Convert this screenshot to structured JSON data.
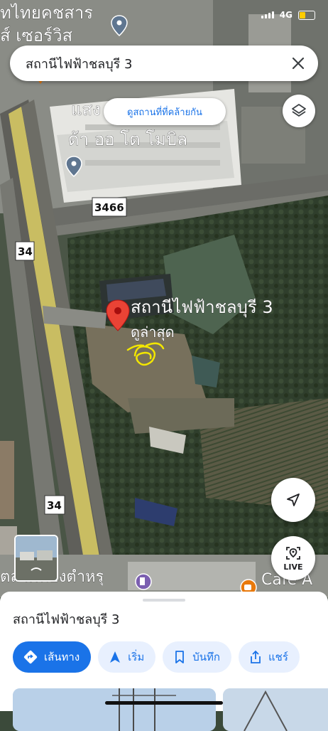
{
  "status_bar": {
    "network": "4G"
  },
  "search": {
    "query": "สถานีไฟฟ้าชลบุรี 3"
  },
  "similar_button": {
    "label": "ดูสถานที่ที่คล้ายกัน"
  },
  "map_labels": {
    "top_left_1": "ทไทยคชสาร",
    "top_left_2": "ส์ เซอร์วิส",
    "building_1": "แสง",
    "building_2": "ด้า ออ โต โมบิล",
    "road_3466": "3466",
    "road_34_a": "34",
    "road_34_b": "34",
    "place_name": "สถานีไฟฟ้าชลบุรี 3",
    "place_sub": "ดูล่าสุด",
    "bottom_left": "ตลาดนองตำหรุ",
    "bottom_right": "Cafe A"
  },
  "live_button": {
    "label": "LIVE"
  },
  "sheet": {
    "title": "สถานีไฟฟ้าชลบุรี 3",
    "actions": [
      {
        "label": "เส้นทาง",
        "icon": "directions-icon"
      },
      {
        "label": "เริ่ม",
        "icon": "navigation-arrow-icon"
      },
      {
        "label": "บันทึก",
        "icon": "bookmark-icon"
      },
      {
        "label": "แชร์",
        "icon": "share-icon"
      }
    ]
  },
  "colors": {
    "accent": "#1a73e8",
    "pin": "#ea4335",
    "annotation": "#f2e600"
  }
}
